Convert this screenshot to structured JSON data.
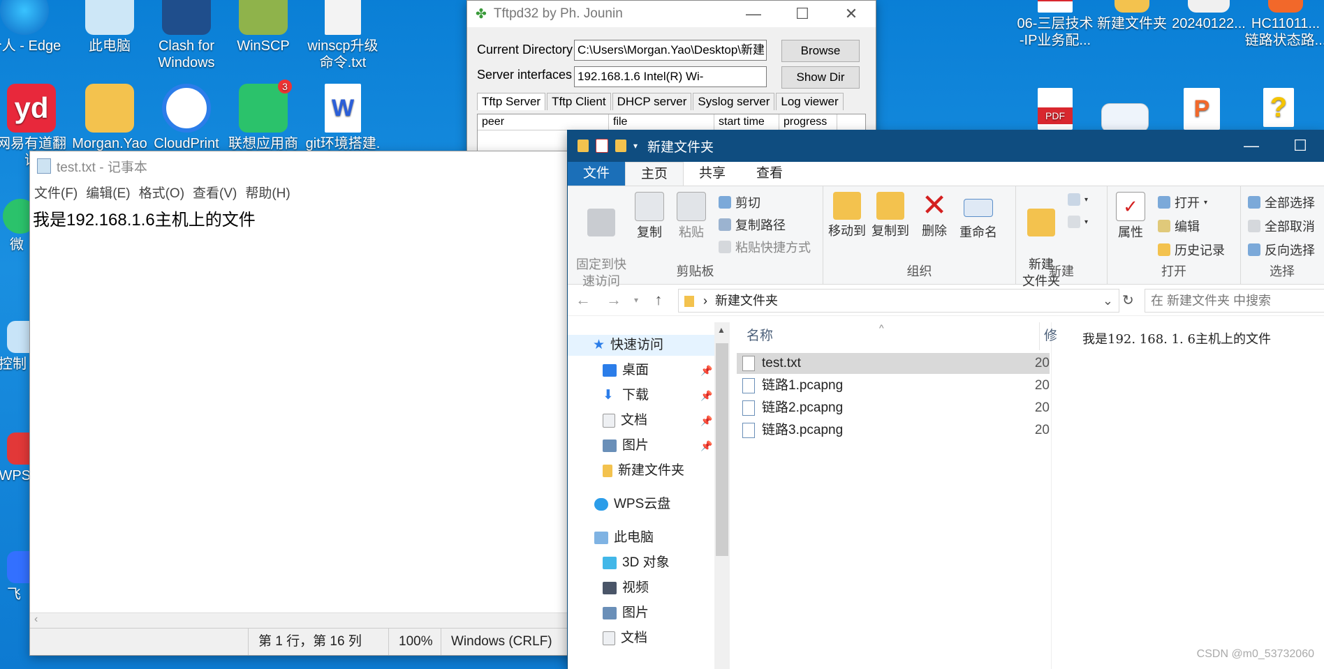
{
  "desktop": {
    "icons": [
      {
        "label": "个人 - Edge"
      },
      {
        "label": "此电脑"
      },
      {
        "label": "Clash for\nWindows"
      },
      {
        "label": "WinSCP"
      },
      {
        "label": "winscp升级\n命令.txt"
      },
      {
        "label": "网易有道翻译"
      },
      {
        "label": "Morgan.Yao"
      },
      {
        "label": "CloudPrint"
      },
      {
        "label": "联想应用商店"
      },
      {
        "label": "git环境搭建."
      },
      {
        "label": "微"
      },
      {
        "label": "控制"
      },
      {
        "label": "WPS"
      },
      {
        "label": "飞"
      },
      {
        "label": "06-三层技术\n-IP业务配..."
      },
      {
        "label": "新建文件夹"
      },
      {
        "label": "20240122..."
      },
      {
        "label": "HC11011...\n链路状态路..."
      }
    ],
    "badge": "3",
    "pdf_label": "PDF"
  },
  "tftpd": {
    "title": "Tftpd32 by Ph. Jounin",
    "current_dir_label": "Current Directory",
    "current_dir_value": "C:\\Users\\Morgan.Yao\\Desktop\\新建",
    "server_if_label": "Server interfaces",
    "server_if_value": "192.168.1.6          Intel(R) Wi-",
    "browse": "Browse",
    "showdir": "Show Dir",
    "tabs": [
      "Tftp Server",
      "Tftp Client",
      "DHCP server",
      "Syslog server",
      "Log viewer"
    ],
    "columns": [
      "peer",
      "file",
      "start time",
      "progress"
    ]
  },
  "notepad": {
    "title": "test.txt - 记事本",
    "menu": [
      "文件(F)",
      "编辑(E)",
      "格式(O)",
      "查看(V)",
      "帮助(H)"
    ],
    "content": "我是192.168.1.6主机上的文件",
    "status": {
      "position": "第 1 行，第 16 列",
      "zoom": "100%",
      "encoding": "Windows (CRLF)"
    }
  },
  "explorer": {
    "title": "新建文件夹",
    "tabs": [
      "文件",
      "主页",
      "共享",
      "查看"
    ],
    "ribbon": {
      "pin": "固定到快\n速访问",
      "copy": "复制",
      "paste": "粘贴",
      "cut": "剪切",
      "copy_path": "复制路径",
      "paste_shortcut": "粘贴快捷方式",
      "clipboard": "剪贴板",
      "move_to": "移动到",
      "copy_to": "复制到",
      "delete": "删除",
      "rename": "重命名",
      "organize": "组织",
      "new_folder": "新建\n文件夹",
      "new": "新建",
      "properties": "属性",
      "open": "打开",
      "edit": "编辑",
      "history": "历史记录",
      "open_group": "打开",
      "select_all": "全部选择",
      "select_none": "全部取消",
      "invert": "反向选择",
      "select_group": "选择"
    },
    "address": "新建文件夹",
    "search_placeholder": "在 新建文件夹 中搜索",
    "nav": [
      {
        "label": "快速访问"
      },
      {
        "label": "桌面"
      },
      {
        "label": "下载"
      },
      {
        "label": "文档"
      },
      {
        "label": "图片"
      },
      {
        "label": "新建文件夹"
      },
      {
        "label": "WPS云盘"
      },
      {
        "label": "此电脑"
      },
      {
        "label": "3D 对象"
      },
      {
        "label": "视频"
      },
      {
        "label": "图片"
      },
      {
        "label": "文档"
      }
    ],
    "col_name": "名称",
    "col_mod": "修",
    "files": [
      {
        "name": "test.txt",
        "date": "20"
      },
      {
        "name": "链路1.pcapng",
        "date": "20"
      },
      {
        "name": "链路2.pcapng",
        "date": "20"
      },
      {
        "name": "链路3.pcapng",
        "date": "20"
      }
    ],
    "preview": "我是192. 168. 1. 6主机上的文件"
  },
  "watermark": "CSDN @m0_53732060"
}
